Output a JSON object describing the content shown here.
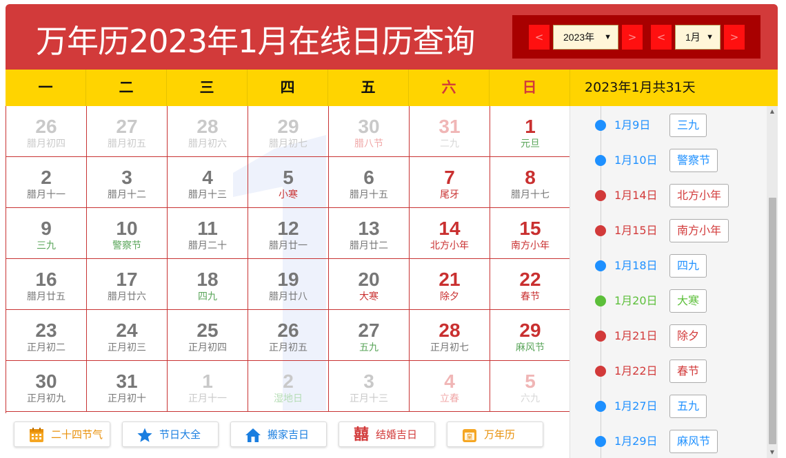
{
  "header": {
    "title": "万年历2023年1月在线日历查询",
    "prev_year": "<",
    "year_value": "2023年",
    "next_year": ">",
    "prev_month": "<",
    "month_value": "1月",
    "next_month": ">"
  },
  "weekdays": [
    "一",
    "二",
    "三",
    "四",
    "五",
    "六",
    "日"
  ],
  "sidebar": {
    "title": "2023年1月共31天",
    "events": [
      {
        "date": "1月9日",
        "tag": "三九",
        "color": "#1e90ff"
      },
      {
        "date": "1月10日",
        "tag": "警察节",
        "color": "#1e90ff"
      },
      {
        "date": "1月14日",
        "tag": "北方小年",
        "color": "#d23a3a"
      },
      {
        "date": "1月15日",
        "tag": "南方小年",
        "color": "#d23a3a"
      },
      {
        "date": "1月18日",
        "tag": "四九",
        "color": "#1e90ff"
      },
      {
        "date": "1月20日",
        "tag": "大寒",
        "color": "#5cbf3a"
      },
      {
        "date": "1月21日",
        "tag": "除夕",
        "color": "#d23a3a"
      },
      {
        "date": "1月22日",
        "tag": "春节",
        "color": "#d23a3a"
      },
      {
        "date": "1月27日",
        "tag": "五九",
        "color": "#1e90ff"
      },
      {
        "date": "1月29日",
        "tag": "麻风节",
        "color": "#1e90ff"
      }
    ]
  },
  "calendar": {
    "weeks": [
      [
        {
          "day": "26",
          "lunar": "腊月初四",
          "other": true
        },
        {
          "day": "27",
          "lunar": "腊月初五",
          "other": true
        },
        {
          "day": "28",
          "lunar": "腊月初六",
          "other": true
        },
        {
          "day": "29",
          "lunar": "腊月初七",
          "other": true
        },
        {
          "day": "30",
          "lunar": "腊八节",
          "other": true,
          "lunar_style": "lred"
        },
        {
          "day": "31",
          "lunar": "二九",
          "other": true,
          "weekend": true,
          "lunar_style": "lgray"
        },
        {
          "day": "1",
          "lunar": "元旦",
          "weekend": true,
          "lunar_style": "green"
        }
      ],
      [
        {
          "day": "2",
          "lunar": "腊月十一"
        },
        {
          "day": "3",
          "lunar": "腊月十二"
        },
        {
          "day": "4",
          "lunar": "腊月十三"
        },
        {
          "day": "5",
          "lunar": "小寒",
          "lunar_style": "red"
        },
        {
          "day": "6",
          "lunar": "腊月十五"
        },
        {
          "day": "7",
          "lunar": "尾牙",
          "weekend": true,
          "lunar_style": "red"
        },
        {
          "day": "8",
          "lunar": "腊月十七",
          "weekend": true
        }
      ],
      [
        {
          "day": "9",
          "lunar": "三九",
          "lunar_style": "green"
        },
        {
          "day": "10",
          "lunar": "警察节",
          "lunar_style": "green"
        },
        {
          "day": "11",
          "lunar": "腊月二十"
        },
        {
          "day": "12",
          "lunar": "腊月廿一"
        },
        {
          "day": "13",
          "lunar": "腊月廿二"
        },
        {
          "day": "14",
          "lunar": "北方小年",
          "weekend": true,
          "lunar_style": "red"
        },
        {
          "day": "15",
          "lunar": "南方小年",
          "weekend": true,
          "lunar_style": "red"
        }
      ],
      [
        {
          "day": "16",
          "lunar": "腊月廿五"
        },
        {
          "day": "17",
          "lunar": "腊月廿六"
        },
        {
          "day": "18",
          "lunar": "四九",
          "lunar_style": "green"
        },
        {
          "day": "19",
          "lunar": "腊月廿八"
        },
        {
          "day": "20",
          "lunar": "大寒",
          "lunar_style": "red"
        },
        {
          "day": "21",
          "lunar": "除夕",
          "weekend": true,
          "lunar_style": "red"
        },
        {
          "day": "22",
          "lunar": "春节",
          "weekend": true,
          "lunar_style": "red"
        }
      ],
      [
        {
          "day": "23",
          "lunar": "正月初二"
        },
        {
          "day": "24",
          "lunar": "正月初三"
        },
        {
          "day": "25",
          "lunar": "正月初四"
        },
        {
          "day": "26",
          "lunar": "正月初五"
        },
        {
          "day": "27",
          "lunar": "五九",
          "lunar_style": "green"
        },
        {
          "day": "28",
          "lunar": "正月初七",
          "weekend": true
        },
        {
          "day": "29",
          "lunar": "麻风节",
          "weekend": true,
          "lunar_style": "green"
        }
      ],
      [
        {
          "day": "30",
          "lunar": "正月初九"
        },
        {
          "day": "31",
          "lunar": "正月初十"
        },
        {
          "day": "1",
          "lunar": "正月十一",
          "other": true
        },
        {
          "day": "2",
          "lunar": "湿地日",
          "other": true,
          "lunar_style": "lgreen"
        },
        {
          "day": "3",
          "lunar": "正月十三",
          "other": true
        },
        {
          "day": "4",
          "lunar": "立春",
          "other": true,
          "weekend": true,
          "lunar_style": "lred"
        },
        {
          "day": "5",
          "lunar": "六九",
          "other": true,
          "weekend": true,
          "lunar_style": "lgray"
        }
      ]
    ]
  },
  "footer_buttons": [
    {
      "label": "二十四节气",
      "icon": "solar-terms-calendar-icon",
      "color": "#e8900a"
    },
    {
      "label": "节日大全",
      "icon": "star-icon",
      "color": "#1a7ee0"
    },
    {
      "label": "搬家吉日",
      "icon": "house-icon",
      "color": "#1a7ee0"
    },
    {
      "label": "结婚吉日",
      "icon": "double-happiness-icon",
      "color": "#d23a3a"
    },
    {
      "label": "万年历",
      "icon": "almanac-calendar-icon",
      "color": "#e8900a"
    }
  ],
  "colors": {
    "header_bg": "#d23a3a",
    "weekbar_bg": "#ffd400",
    "grid_border": "#c83232"
  }
}
